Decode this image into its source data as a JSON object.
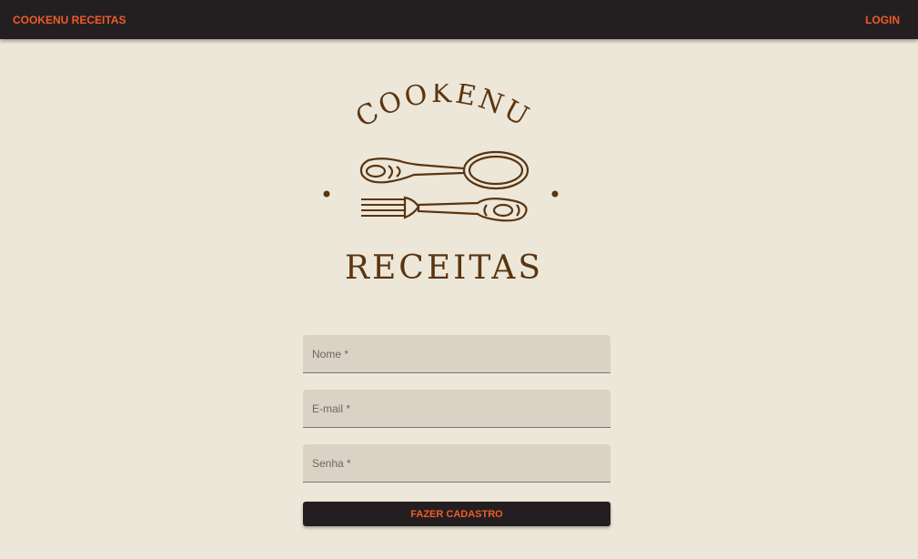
{
  "appbar": {
    "brand_label": "COOKENU RECEITAS",
    "login_label": "LOGIN"
  },
  "logo": {
    "top_text": "COOKENU",
    "bottom_text": "RECEITAS",
    "icon": "spoon-and-fork-icon"
  },
  "form": {
    "fields": [
      {
        "label": "Nome *",
        "value": ""
      },
      {
        "label": "E-mail *",
        "value": ""
      },
      {
        "label": "Senha *",
        "value": ""
      }
    ],
    "submit_label": "FAZER CADASTRO"
  },
  "colors": {
    "background": "#ede7d9",
    "appbar": "#231f20",
    "accent": "#f05a28",
    "logo_brown": "#5a3510",
    "field_bg": "#dad2c4"
  }
}
